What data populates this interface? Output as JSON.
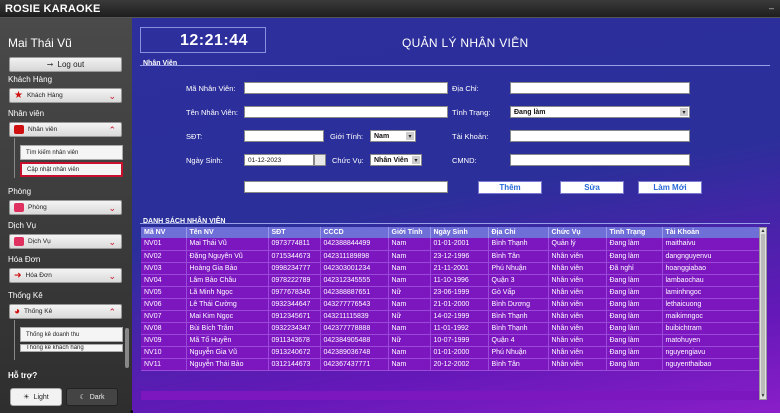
{
  "app": {
    "title": "ROSIE KARAOKE",
    "window_button": "–"
  },
  "sidebar": {
    "user_name": "Mai Thái Vũ",
    "logout": "Log out",
    "sections": [
      {
        "label": "Khách Hàng",
        "button": "Khách Hàng",
        "icon": "customer-icon",
        "color": "#d01010"
      },
      {
        "label": "Nhân viên",
        "button": "Nhân viên",
        "icon": "staff-icon",
        "color": "#d01010"
      },
      {
        "label": "Phòng",
        "button": "Phòng",
        "icon": "room-icon",
        "color": "#e03060"
      },
      {
        "label": "Dịch Vụ",
        "button": "Dịch Vụ",
        "icon": "service-icon",
        "color": "#e03060"
      },
      {
        "label": "Hóa Đơn",
        "button": "Hóa Đơn",
        "icon": "invoice-icon",
        "color": "#d01010"
      },
      {
        "label": "Thống Kê",
        "button": "Thống Kê",
        "icon": "chart-icon",
        "color": "#d01010"
      }
    ],
    "staff_submenu": [
      "Tìm kiếm nhân viên",
      "Cập nhật nhân viên"
    ],
    "stats_submenu": [
      "Thống kê doanh thu",
      "Thống kê khách hàng"
    ],
    "help": "Hỗ trợ?",
    "theme_light": "Light",
    "theme_dark": "Dark"
  },
  "header": {
    "clock": "12:21:44",
    "title": "QUẢN LÝ NHÂN VIÊN"
  },
  "form": {
    "group_title": "Nhân Viên",
    "ma_label": "Mã Nhân Viên:",
    "ten_label": "Tên Nhân Viên:",
    "sdt_label": "SĐT:",
    "gioitinh_label": "Giới Tính:",
    "gioitinh_value": "Nam",
    "ngaysinh_label": "Ngày Sinh:",
    "ngaysinh_value": "01-12-2023",
    "chucvu_label": "Chức Vụ:",
    "chucvu_value": "Nhân Viên",
    "diachi_label": "Địa Chỉ:",
    "tinhtrang_label": "Tình Trạng:",
    "tinhtrang_value": "Đang làm",
    "taikhoan_label": "Tài Khoản:",
    "cmnd_label": "CMND:",
    "btn_add": "Thêm",
    "btn_edit": "Sửa",
    "btn_new": "Làm Mới"
  },
  "list": {
    "title": "DANH SÁCH NHÂN VIÊN",
    "columns": [
      "Mã NV",
      "Tên NV",
      "SĐT",
      "CCCD",
      "Giới Tính",
      "Ngày Sinh",
      "Địa Chỉ",
      "Chức Vụ",
      "Tình Trạng",
      "Tài Khoản"
    ],
    "rows": [
      [
        "NV01",
        "Mai Thái Vũ",
        "0973774811",
        "042388844499",
        "Nam",
        "01-01-2001",
        "Bình Thạnh",
        "Quản lý",
        "Đang làm",
        "maithaivu"
      ],
      [
        "NV02",
        "Đặng Nguyên Vũ",
        "0715344673",
        "042311189898",
        "Nam",
        "23-12-1996",
        "Bình Tân",
        "Nhân viên",
        "Đang làm",
        "dangnguyenvu"
      ],
      [
        "NV03",
        "Hoàng Gia Bảo",
        "0998234777",
        "042303001234",
        "Nam",
        "21-11-2001",
        "Phú Nhuận",
        "Nhân viên",
        "Đã nghỉ",
        "hoanggiabao"
      ],
      [
        "NV04",
        "Lâm Bảo Châu",
        "0978222789",
        "042312345555",
        "Nam",
        "11-10-1996",
        "Quận 3",
        "Nhân viên",
        "Đang làm",
        "lambaochau"
      ],
      [
        "NV05",
        "Lã Minh Ngọc",
        "0977678345",
        "042388887651",
        "Nữ",
        "23-06-1999",
        "Gò Vấp",
        "Nhân viên",
        "Đang làm",
        "laminhngoc"
      ],
      [
        "NV06",
        "Lê Thái Cường",
        "0932344647",
        "043277776543",
        "Nam",
        "21-01-2000",
        "Bình Dương",
        "Nhân viên",
        "Đang làm",
        "lethaicuong"
      ],
      [
        "NV07",
        "Mai Kim Ngọc",
        "0912345671",
        "043211115839",
        "Nữ",
        "14-02-1999",
        "Bình Thạnh",
        "Nhân viên",
        "Đang làm",
        "maikimngoc"
      ],
      [
        "NV08",
        "Bùi Bích Trâm",
        "0932234347",
        "042377778888",
        "Nam",
        "11-01-1992",
        "Bình Thạnh",
        "Nhân viên",
        "Đang làm",
        "buibichtram"
      ],
      [
        "NV09",
        "Mã Tố Huyền",
        "0911343678",
        "042384905488",
        "Nữ",
        "10-07-1999",
        "Quận 4",
        "Nhân viên",
        "Đang làm",
        "matohuyen"
      ],
      [
        "NV10",
        "Nguyễn Gia Vũ",
        "0913240672",
        "042389036748",
        "Nam",
        "01-01-2000",
        "Phú Nhuận",
        "Nhân viên",
        "Đang làm",
        "nguyengiavu"
      ],
      [
        "NV11",
        "Nguyễn Thái Bảo",
        "0312144673",
        "042367437771",
        "Nam",
        "20-12-2002",
        "Bình Tân",
        "Nhân viên",
        "Đang làm",
        "nguyenthaibao"
      ]
    ]
  },
  "colors": {
    "main_top": "#2d2f9c",
    "main_bottom": "#8a1ec8",
    "row_bg": "#7c17c0",
    "header_bg": "#6f6fd8",
    "accent_red": "#c8102e"
  }
}
